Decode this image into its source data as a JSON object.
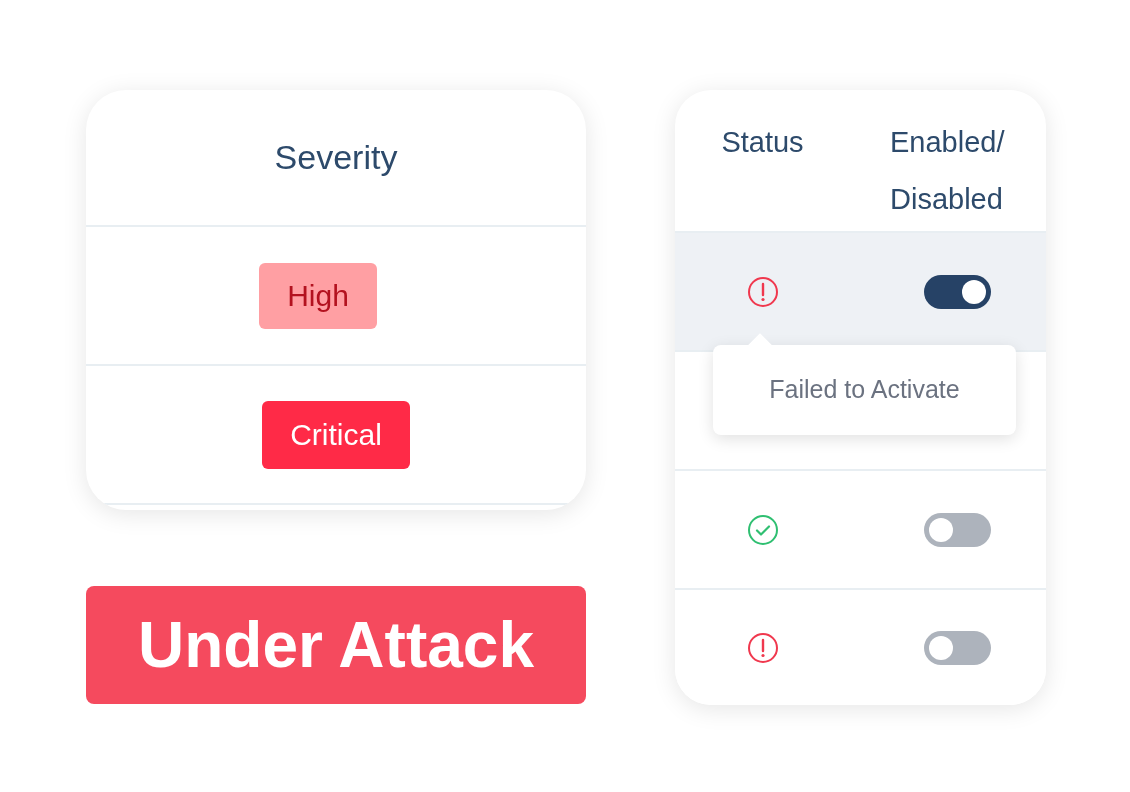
{
  "severity_table": {
    "header": "Severity",
    "rows": [
      {
        "kind": "high",
        "label": "High"
      },
      {
        "kind": "critical",
        "label": "Critical"
      }
    ]
  },
  "banner": "Under Attack",
  "status_table": {
    "columns": [
      "Status",
      "Enabled/\nDisabled"
    ],
    "rows": [
      {
        "kind": "error",
        "enabled": true,
        "selected": true
      },
      {
        "kind": "covered"
      },
      {
        "kind": "ok",
        "enabled": false,
        "selected": false
      },
      {
        "kind": "error",
        "enabled": false,
        "selected": false
      }
    ],
    "tooltip": "Failed to Activate"
  }
}
